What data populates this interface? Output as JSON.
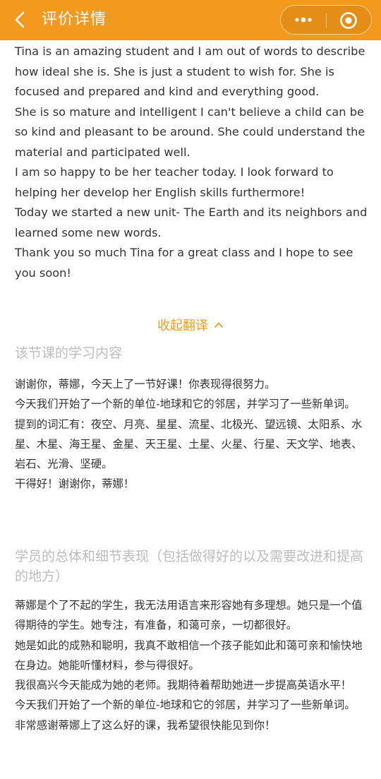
{
  "header": {
    "title": "评价详情",
    "back_icon": "chevron-left-icon",
    "more_icon": "more-dots-icon",
    "close_icon": "target-close-icon",
    "color": "#f39a1e"
  },
  "english": {
    "paragraphs": [
      "Tina is an amazing student and I am out of words to describe how ideal she is. She is just a student to wish for. She is focused and prepared and kind and everything good.",
      "She is so mature and intelligent I can't believe a child can be so kind and pleasant to be around. She could understand the material and participated well.",
      "I am so happy to be her teacher today. I look forward to helping her develop her English skills furthermore!",
      "Today we started a new unit- The Earth and its neighbors and learned some new words.",
      "Thank you so much Tina for a great class and I hope to see you soon!"
    ]
  },
  "collapse_label": "收起翻译",
  "lesson": {
    "title": "该节课的学习内容",
    "paragraphs": [
      "谢谢你，蒂娜，今天上了一节好课！你表现得很努力。",
      "今天我们开始了一个新的单位-地球和它的邻居，并学习了一些新单词。",
      "提到的词汇有：夜空、月亮、星星、流星、北极光、望远镜、太阳系、水星、木星、海王星、金星、天王星、土星、火星、行星、天文学、地表、岩石、光滑、坚硬。",
      "干得好！谢谢你，蒂娜！"
    ]
  },
  "performance": {
    "title": "学员的总体和细节表现（包括做得好的以及需要改进和提高的地方）",
    "paragraphs": [
      "蒂娜是个了不起的学生，我无法用语言来形容她有多理想。她只是一个值得期待的学生。她专注，有准备，和蔼可亲，一切都很好。",
      "她是如此的成熟和聪明，我真不敢相信一个孩子能如此和蔼可亲和愉快地在身边。她能听懂材料，参与得很好。",
      "我很高兴今天能成为她的老师。我期待着帮助她进一步提高英语水平！",
      "今天我们开始了一个新的单位-地球和它的邻居，并学习了一些新单词。",
      "非常感谢蒂娜上了这么好的课，我希望很快能见到你！"
    ]
  }
}
